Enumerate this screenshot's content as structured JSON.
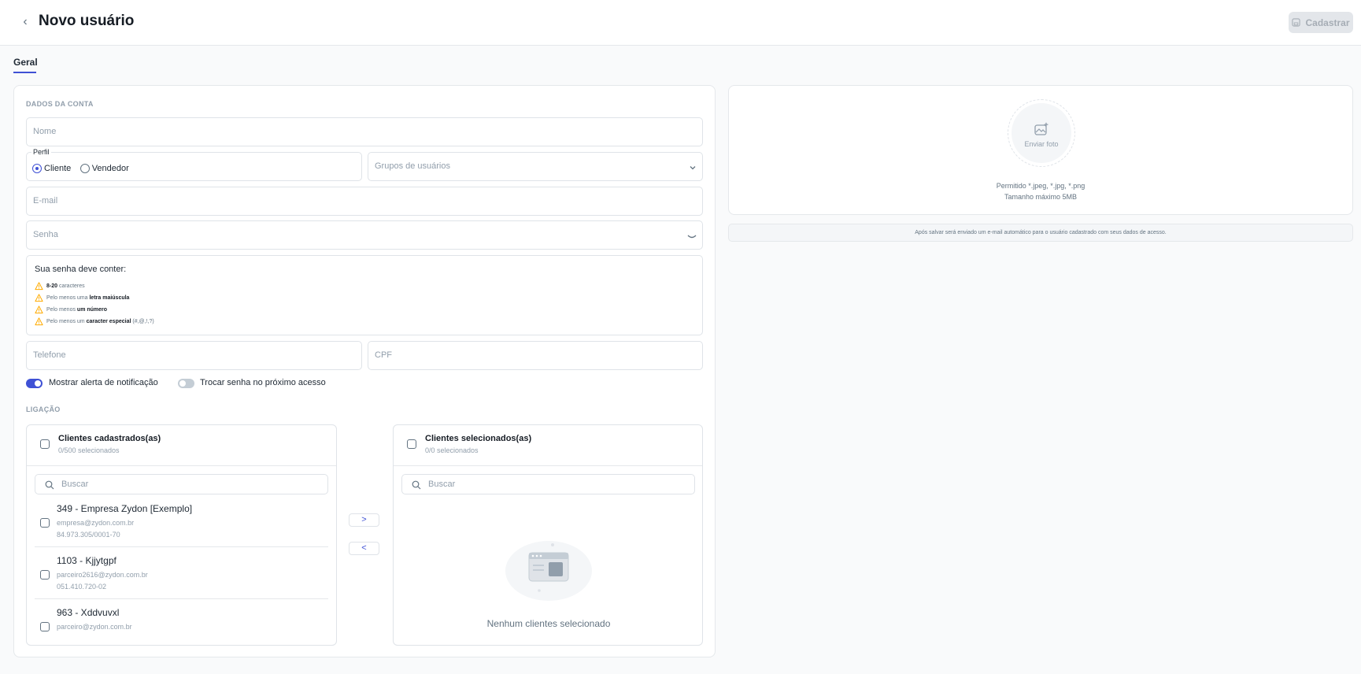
{
  "header": {
    "title": "Novo usuário",
    "back_icon": "chevron-left-icon",
    "save_label": "Cadastrar"
  },
  "tabs": [
    {
      "label": "Geral",
      "active": true
    }
  ],
  "account": {
    "section_title": "DADOS DA CONTA",
    "name_placeholder": "Nome",
    "profile_label": "Perfil",
    "profile_options": [
      {
        "label": "Cliente",
        "selected": true
      },
      {
        "label": "Vendedor",
        "selected": false
      }
    ],
    "groups_placeholder": "Grupos de usuários",
    "email_placeholder": "E-mail",
    "password_placeholder": "Senha",
    "password_rules_title": "Sua senha deve conter:",
    "password_rules": [
      {
        "prefix": "",
        "bold": "8-20",
        "suffix": " caracteres"
      },
      {
        "prefix": "Pelo menos uma ",
        "bold": "letra maiúscula",
        "suffix": ""
      },
      {
        "prefix": "Pelo menos ",
        "bold": "um número",
        "suffix": ""
      },
      {
        "prefix": "Pelo menos um ",
        "bold": "caracter especial",
        "suffix": " (#,@,!,?)"
      }
    ],
    "phone_placeholder": "Telefone",
    "cpf_placeholder": "CPF",
    "toggles": [
      {
        "label": "Mostrar alerta de notificação",
        "on": true
      },
      {
        "label": "Trocar senha no próximo acesso",
        "on": false
      }
    ]
  },
  "link": {
    "section_title": "LIGAÇÃO",
    "left": {
      "title": "Clientes cadastrados(as)",
      "count": "0/500 selecionados",
      "search_placeholder": "Buscar",
      "items": [
        {
          "name": "349 - Empresa Zydon [Exemplo]",
          "email": "empresa@zydon.com.br",
          "doc": "84.973.305/0001-70"
        },
        {
          "name": "1103 - Kjjytgpf",
          "email": "parceiro2616@zydon.com.br",
          "doc": "051.410.720-02"
        },
        {
          "name": "963 - Xddvuvxl",
          "email": "parceiro@zydon.com.br",
          "doc": ""
        }
      ]
    },
    "move_right": ">",
    "move_left": "<",
    "right": {
      "title": "Clientes selecionados(as)",
      "count": "0/0 selecionados",
      "search_placeholder": "Buscar",
      "empty_text": "Nenhum clientes selecionado"
    }
  },
  "photo": {
    "upload_label": "Enviar foto",
    "allowed": "Permitido *.jpeg, *.jpg, *.png",
    "max_size": "Tamanho máximo 5MB"
  },
  "info_note": "Após salvar será enviado um e-mail automático para o usuário cadastrado com seus dados de acesso.",
  "colors": {
    "primary": "#3f51d5",
    "warning": "#ffab00",
    "border": "#dfe3e8",
    "muted": "#919eab"
  }
}
